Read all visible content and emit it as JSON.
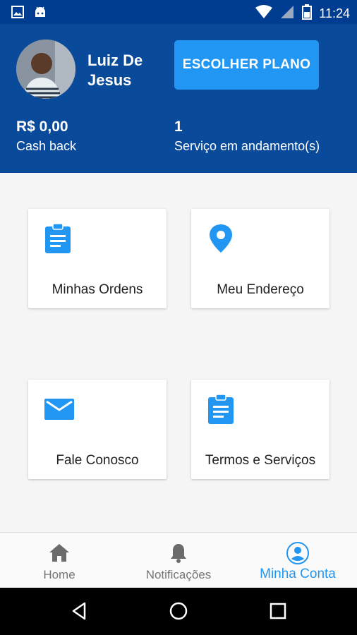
{
  "status_bar": {
    "time": "11:24",
    "icons": [
      "image-icon",
      "android-icon",
      "wifi-icon",
      "signal-icon",
      "battery-icon"
    ]
  },
  "header": {
    "user_name": "Luiz De Jesus",
    "plan_button_label": "ESCOLHER PLANO",
    "cashback_value": "R$ 0,00",
    "cashback_label": "Cash back",
    "services_count": "1",
    "services_label": "Serviço em andamento(s)"
  },
  "cards": [
    {
      "label": "Minhas Ordens",
      "icon": "clipboard-icon"
    },
    {
      "label": "Meu Endereço",
      "icon": "location-pin-icon"
    },
    {
      "label": "Fale Conosco",
      "icon": "mail-icon"
    },
    {
      "label": "Termos e Serviços",
      "icon": "clipboard-icon"
    }
  ],
  "bottom_nav": {
    "items": [
      {
        "label": "Home",
        "icon": "home-icon",
        "active": false
      },
      {
        "label": "Notificações",
        "icon": "bell-icon",
        "active": false
      },
      {
        "label": "Minha Conta",
        "icon": "account-circle-icon",
        "active": true
      }
    ]
  },
  "system_nav": [
    "back-icon",
    "home-circle-icon",
    "recents-icon"
  ],
  "colors": {
    "header_bg": "#0a4a9a",
    "status_bar_bg": "#003c8f",
    "accent": "#2196f3",
    "page_bg": "#f5f5f5"
  }
}
